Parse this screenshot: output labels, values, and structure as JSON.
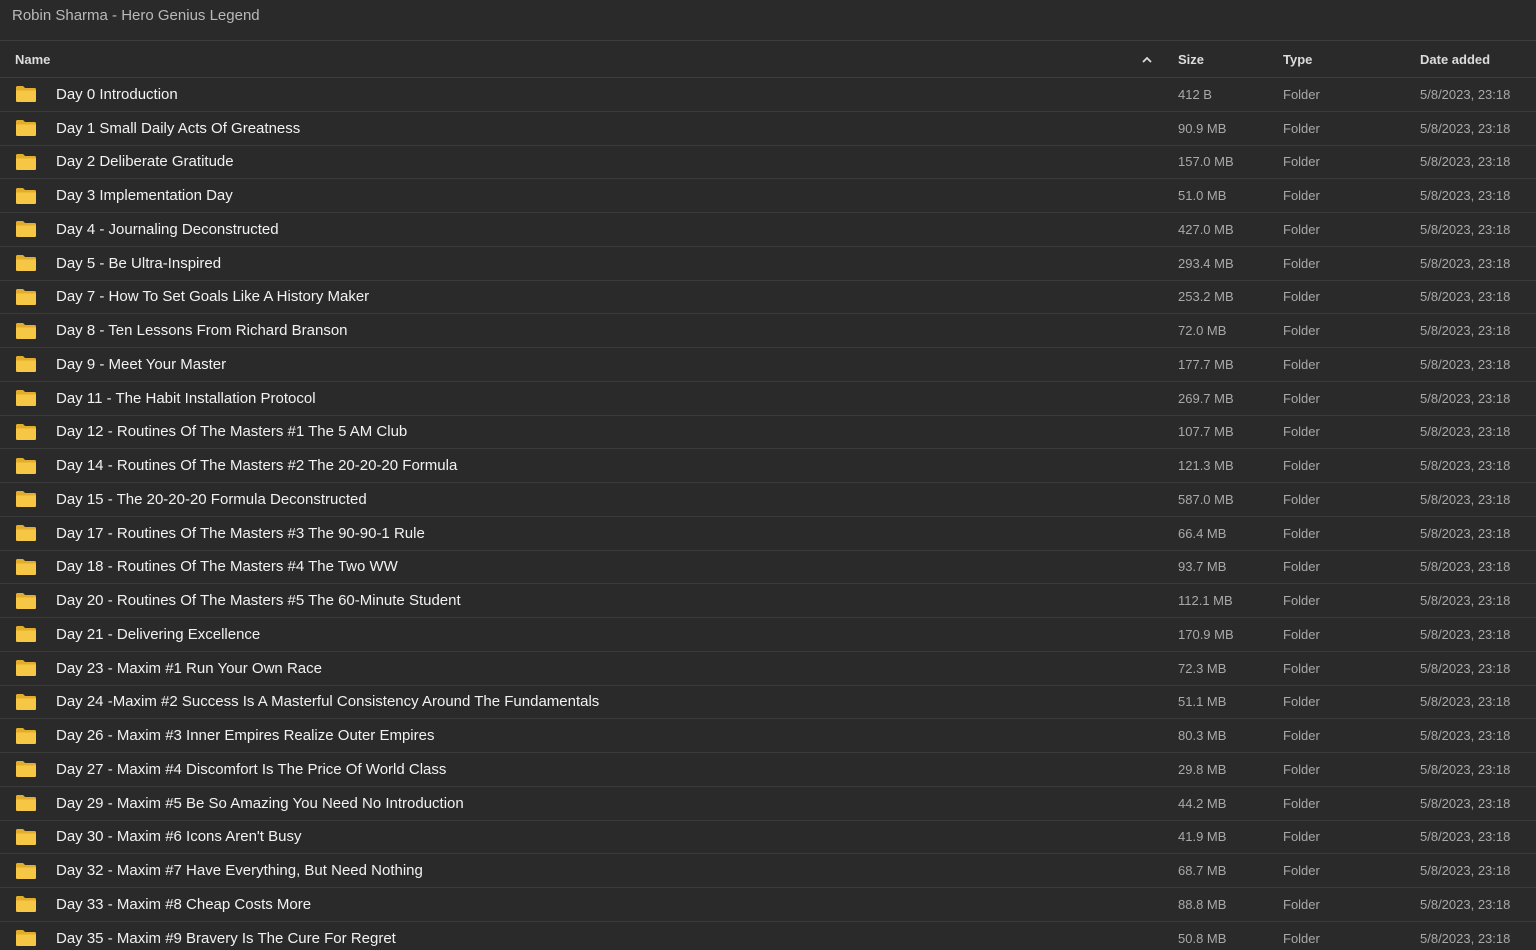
{
  "window": {
    "title": "Robin Sharma - Hero Genius Legend"
  },
  "columns": {
    "name": "Name",
    "size": "Size",
    "type": "Type",
    "date_added": "Date added",
    "sort_icon": "chevron-up-icon"
  },
  "colors": {
    "background": "#2a2a2a",
    "folder": "#f6c744",
    "folder_tab": "#e2ad2a"
  },
  "rows": [
    {
      "name": "Day 0 Introduction",
      "size": "412 B",
      "type": "Folder",
      "date": "5/8/2023, 23:18"
    },
    {
      "name": "Day 1 Small Daily Acts Of Greatness",
      "size": "90.9 MB",
      "type": "Folder",
      "date": "5/8/2023, 23:18"
    },
    {
      "name": "Day 2 Deliberate Gratitude",
      "size": "157.0 MB",
      "type": "Folder",
      "date": "5/8/2023, 23:18"
    },
    {
      "name": "Day 3 Implementation Day",
      "size": "51.0 MB",
      "type": "Folder",
      "date": "5/8/2023, 23:18"
    },
    {
      "name": "Day 4 - Journaling Deconstructed",
      "size": "427.0 MB",
      "type": "Folder",
      "date": "5/8/2023, 23:18"
    },
    {
      "name": "Day 5 - Be Ultra-Inspired",
      "size": "293.4 MB",
      "type": "Folder",
      "date": "5/8/2023, 23:18"
    },
    {
      "name": "Day 7 - How To Set Goals Like A History Maker",
      "size": "253.2 MB",
      "type": "Folder",
      "date": "5/8/2023, 23:18"
    },
    {
      "name": "Day 8 - Ten Lessons From Richard Branson",
      "size": "72.0 MB",
      "type": "Folder",
      "date": "5/8/2023, 23:18"
    },
    {
      "name": "Day 9 - Meet Your Master",
      "size": "177.7 MB",
      "type": "Folder",
      "date": "5/8/2023, 23:18"
    },
    {
      "name": "Day 11 - The Habit Installation Protocol",
      "size": "269.7 MB",
      "type": "Folder",
      "date": "5/8/2023, 23:18"
    },
    {
      "name": "Day 12 - Routines Of The Masters #1 The 5 AM Club",
      "size": "107.7 MB",
      "type": "Folder",
      "date": "5/8/2023, 23:18"
    },
    {
      "name": "Day 14 - Routines Of The Masters #2 The 20-20-20 Formula",
      "size": "121.3 MB",
      "type": "Folder",
      "date": "5/8/2023, 23:18"
    },
    {
      "name": "Day 15 - The 20-20-20 Formula Deconstructed",
      "size": "587.0 MB",
      "type": "Folder",
      "date": "5/8/2023, 23:18"
    },
    {
      "name": "Day 17 - Routines Of The Masters #3 The 90-90-1 Rule",
      "size": "66.4 MB",
      "type": "Folder",
      "date": "5/8/2023, 23:18"
    },
    {
      "name": "Day 18 - Routines Of The Masters #4 The Two WW",
      "size": "93.7 MB",
      "type": "Folder",
      "date": "5/8/2023, 23:18"
    },
    {
      "name": "Day 20 - Routines Of The Masters #5 The 60-Minute Student",
      "size": "112.1 MB",
      "type": "Folder",
      "date": "5/8/2023, 23:18"
    },
    {
      "name": "Day 21 - Delivering Excellence",
      "size": "170.9 MB",
      "type": "Folder",
      "date": "5/8/2023, 23:18"
    },
    {
      "name": "Day 23 - Maxim #1 Run Your Own Race",
      "size": "72.3 MB",
      "type": "Folder",
      "date": "5/8/2023, 23:18"
    },
    {
      "name": "Day 24 -Maxim #2 Success Is A Masterful Consistency Around The Fundamentals",
      "size": "51.1 MB",
      "type": "Folder",
      "date": "5/8/2023, 23:18"
    },
    {
      "name": "Day 26 - Maxim #3 Inner Empires Realize Outer Empires",
      "size": "80.3 MB",
      "type": "Folder",
      "date": "5/8/2023, 23:18"
    },
    {
      "name": "Day 27 - Maxim #4 Discomfort Is The Price Of World Class",
      "size": "29.8 MB",
      "type": "Folder",
      "date": "5/8/2023, 23:18"
    },
    {
      "name": "Day 29 - Maxim #5 Be So Amazing You Need No Introduction",
      "size": "44.2 MB",
      "type": "Folder",
      "date": "5/8/2023, 23:18"
    },
    {
      "name": "Day 30 - Maxim #6 Icons Aren't Busy",
      "size": "41.9 MB",
      "type": "Folder",
      "date": "5/8/2023, 23:18"
    },
    {
      "name": "Day 32 - Maxim #7 Have Everything, But Need Nothing",
      "size": "68.7 MB",
      "type": "Folder",
      "date": "5/8/2023, 23:18"
    },
    {
      "name": "Day 33 - Maxim #8 Cheap Costs More",
      "size": "88.8 MB",
      "type": "Folder",
      "date": "5/8/2023, 23:18"
    },
    {
      "name": "Day 35 - Maxim #9 Bravery Is The Cure For Regret",
      "size": "50.8 MB",
      "type": "Folder",
      "date": "5/8/2023, 23:18"
    }
  ]
}
